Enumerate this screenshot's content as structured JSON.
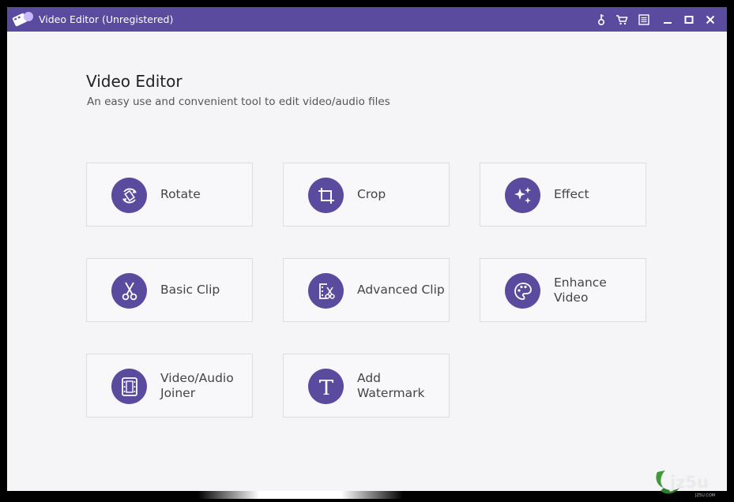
{
  "window": {
    "title": "Video Editor (Unregistered)",
    "accent_color": "#5a4b9e"
  },
  "titlebar_icons": [
    "key-icon",
    "cart-icon",
    "feedback-icon",
    "minimize-icon",
    "maximize-icon",
    "close-icon"
  ],
  "main": {
    "heading": "Video Editor",
    "subheading": "An easy use and convenient tool to edit video/audio files"
  },
  "tools": [
    {
      "label": "Rotate",
      "icon": "rotate-icon"
    },
    {
      "label": "Crop",
      "icon": "crop-icon"
    },
    {
      "label": "Effect",
      "icon": "sparkle-icon"
    },
    {
      "label": "Basic Clip",
      "icon": "scissors-icon"
    },
    {
      "label": "Advanced Clip",
      "icon": "film-scissors-icon"
    },
    {
      "label": "Enhance Video",
      "icon": "palette-icon"
    },
    {
      "label": "Video/Audio Joiner",
      "icon": "film-icon"
    },
    {
      "label": "Add Watermark",
      "icon": "text-t-icon"
    }
  ],
  "watermark": {
    "text": "jz5u",
    "subtext": "JZ5U.COM"
  }
}
